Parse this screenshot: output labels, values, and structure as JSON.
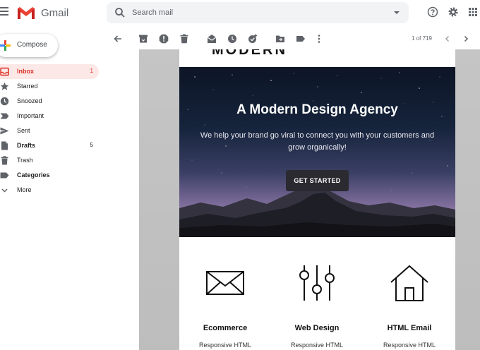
{
  "app": {
    "name": "Gmail"
  },
  "search": {
    "placeholder": "Search mail"
  },
  "sidebar": {
    "compose_label": "Compose",
    "items": [
      {
        "label": "Inbox",
        "count": "1",
        "icon": "inbox-icon",
        "active": true
      },
      {
        "label": "Starred",
        "count": "",
        "icon": "star-icon"
      },
      {
        "label": "Snoozed",
        "count": "",
        "icon": "clock-icon"
      },
      {
        "label": "Important",
        "count": "",
        "icon": "label-important-icon"
      },
      {
        "label": "Sent",
        "count": "",
        "icon": "send-icon"
      },
      {
        "label": "Drafts",
        "count": "5",
        "icon": "draft-icon",
        "bold": true
      },
      {
        "label": "Trash",
        "count": "",
        "icon": "trash-icon"
      },
      {
        "label": "Categories",
        "count": "",
        "icon": "label-icon",
        "bold": true
      },
      {
        "label": "More",
        "count": "",
        "icon": "chevron-down-icon"
      }
    ]
  },
  "toolbar": {
    "icons": [
      "back-arrow-icon",
      "archive-icon",
      "report-spam-icon",
      "delete-icon",
      "mark-unread-icon",
      "snooze-icon",
      "add-task-icon",
      "move-to-icon",
      "labels-icon",
      "more-vert-icon"
    ],
    "pager": "1 of 719"
  },
  "email": {
    "brand_partial": "MODERN",
    "hero": {
      "title": "A Modern Design Agency",
      "subtitle": "We help your brand go viral to connect you with your customers and grow organically!",
      "cta": "GET STARTED"
    },
    "features": [
      {
        "title": "Ecommerce",
        "subtitle": "Responsive HTML",
        "icon": "envelope-icon"
      },
      {
        "title": "Web Design",
        "subtitle": "Responsive HTML",
        "icon": "sliders-icon"
      },
      {
        "title": "HTML Email",
        "subtitle": "Responsive HTML",
        "icon": "home-icon"
      }
    ]
  },
  "colors": {
    "gmail_red": "#d93025",
    "inbox_active_bg": "#fce8e6",
    "search_bg": "#f1f3f4",
    "cta_bg": "#2a2a30"
  }
}
